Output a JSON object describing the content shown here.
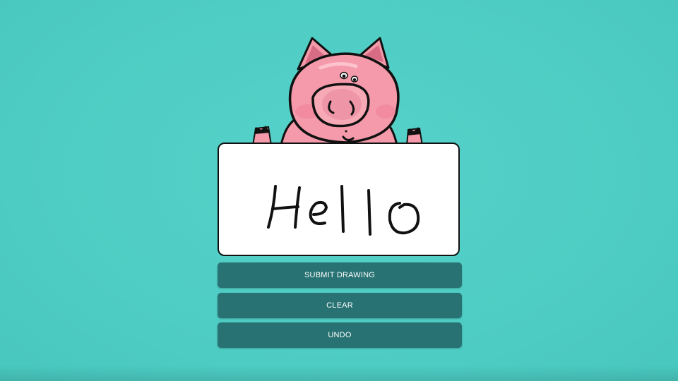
{
  "theme": {
    "background": "#4ecdc4",
    "button": "#287273",
    "button_text": "#ffffff",
    "board": "#ffffff",
    "pig_pink": "#f59aaa",
    "ink": "#111111"
  },
  "mascot": {
    "icon": "pig-icon"
  },
  "canvas": {
    "drawn_text": "Hello"
  },
  "actions": {
    "submit_label": "SUBMIT DRAWING",
    "clear_label": "CLEAR",
    "undo_label": "UNDO"
  }
}
